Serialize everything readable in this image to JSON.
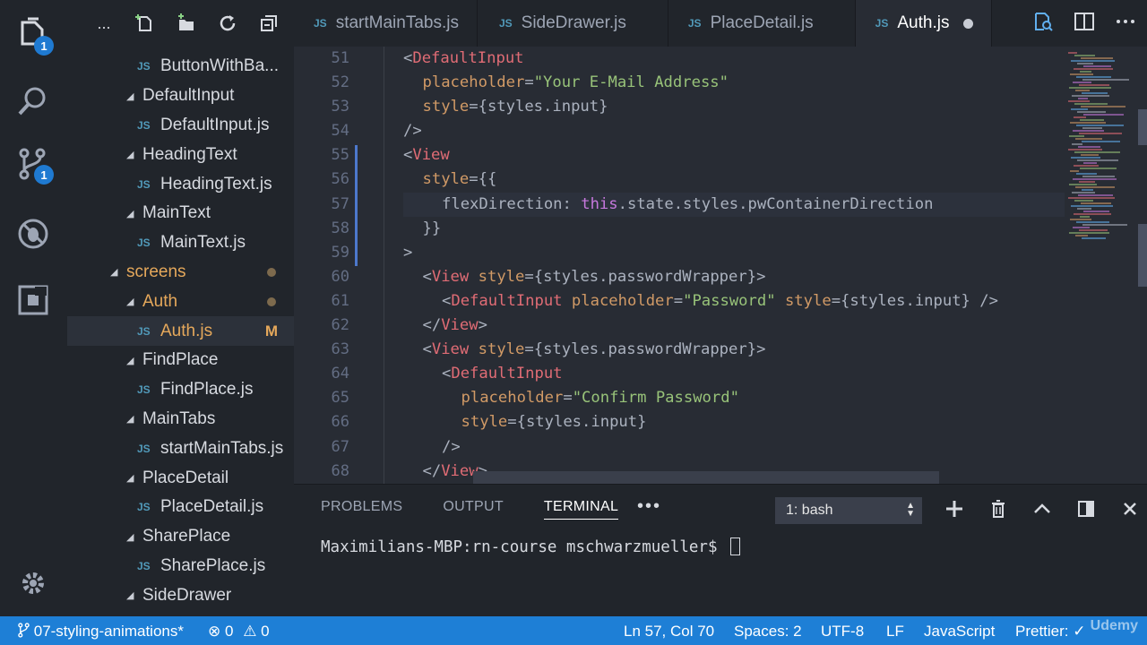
{
  "activity_bar": {
    "icons": [
      "explorer-icon",
      "search-icon",
      "source-control-icon",
      "debug-icon",
      "extensions-icon",
      "settings-gear-icon"
    ],
    "explorer_badge": "1",
    "scm_badge": "1"
  },
  "sidebar": {
    "toolbar_more": "...",
    "tree": [
      {
        "label": "ButtonWithBa...",
        "type": "file",
        "depth": 3
      },
      {
        "label": "DefaultInput",
        "type": "folder",
        "depth": 2
      },
      {
        "label": "DefaultInput.js",
        "type": "file",
        "depth": 3
      },
      {
        "label": "HeadingText",
        "type": "folder",
        "depth": 2
      },
      {
        "label": "HeadingText.js",
        "type": "file",
        "depth": 3
      },
      {
        "label": "MainText",
        "type": "folder",
        "depth": 2
      },
      {
        "label": "MainText.js",
        "type": "file",
        "depth": 3
      },
      {
        "label": "screens",
        "type": "folder",
        "depth": 1,
        "modified": true
      },
      {
        "label": "Auth",
        "type": "folder",
        "depth": 2,
        "modified": true
      },
      {
        "label": "Auth.js",
        "type": "file",
        "depth": 3,
        "flag": "M",
        "active": true
      },
      {
        "label": "FindPlace",
        "type": "folder",
        "depth": 2
      },
      {
        "label": "FindPlace.js",
        "type": "file",
        "depth": 3
      },
      {
        "label": "MainTabs",
        "type": "folder",
        "depth": 2
      },
      {
        "label": "startMainTabs.js",
        "type": "file",
        "depth": 3
      },
      {
        "label": "PlaceDetail",
        "type": "folder",
        "depth": 2
      },
      {
        "label": "PlaceDetail.js",
        "type": "file",
        "depth": 3
      },
      {
        "label": "SharePlace",
        "type": "folder",
        "depth": 2
      },
      {
        "label": "SharePlace.js",
        "type": "file",
        "depth": 3
      },
      {
        "label": "SideDrawer",
        "type": "folder",
        "depth": 2
      }
    ]
  },
  "tabs": [
    {
      "label": "startMainTabs.js",
      "active": false
    },
    {
      "label": "SideDrawer.js",
      "active": false
    },
    {
      "label": "PlaceDetail.js",
      "active": false
    },
    {
      "label": "Auth.js",
      "active": true,
      "dirty": true
    }
  ],
  "editor": {
    "line_numbers": [
      "51",
      "52",
      "53",
      "54",
      "55",
      "56",
      "57",
      "58",
      "59",
      "60",
      "61",
      "62",
      "63",
      "64",
      "65",
      "66",
      "67",
      "68"
    ],
    "lines": [
      "<DefaultInput",
      "placeholder=\"Your E-Mail Address\"",
      "style={styles.input}",
      "/>",
      "<View",
      "style={{",
      "flexDirection: this.state.styles.pwContainerDirection",
      "}}",
      ">",
      "<View style={styles.passwordWrapper}>",
      "<DefaultInput placeholder=\"Password\" style={styles.input} />",
      "</View>",
      "<View style={styles.passwordWrapper}>",
      "<DefaultInput",
      "placeholder=\"Confirm Password\"",
      "style={styles.input}",
      "/>",
      "</View>"
    ]
  },
  "panel": {
    "tabs": [
      "PROBLEMS",
      "OUTPUT",
      "TERMINAL"
    ],
    "active_tab": "TERMINAL",
    "more": "•••",
    "terminal_select": "1: bash",
    "prompt": "Maximilians-MBP:rn-course mschwarzmueller$ "
  },
  "statusbar": {
    "branch": "07-styling-animations*",
    "errors": "0",
    "warnings": "0",
    "position": "Ln 57, Col 70",
    "spaces": "Spaces: 2",
    "encoding": "UTF-8",
    "eol": "LF",
    "language": "JavaScript",
    "formatter": "Prettier: ✓",
    "watermark": "Udemy"
  },
  "colors": {
    "status_bar": "#1e7fd6",
    "badge": "#1f7ad1",
    "modified": "#e5a85b",
    "tag": "#e06c75",
    "string": "#98c379",
    "attribute": "#d19a66"
  }
}
